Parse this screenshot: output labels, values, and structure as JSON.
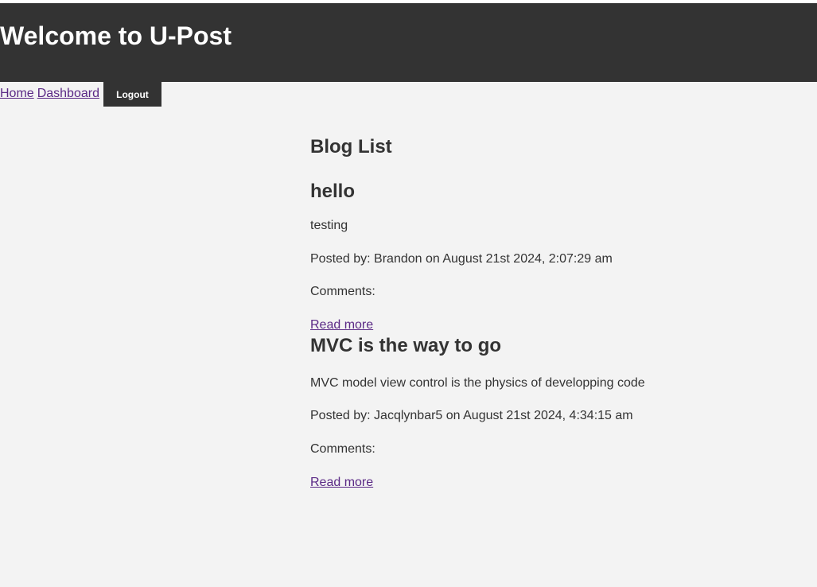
{
  "header": {
    "title": "Welcome to U-Post"
  },
  "nav": {
    "home": "Home",
    "dashboard": "Dashboard",
    "logout": "Logout"
  },
  "main": {
    "title": "Blog List",
    "posts": [
      {
        "title": "hello",
        "body": "testing",
        "meta": "Posted by: Brandon on August 21st 2024, 2:07:29 am",
        "comments": "Comments:",
        "read_more": "Read more"
      },
      {
        "title": "MVC is the way to go",
        "body": "MVC model view control is the physics of developping code",
        "meta": "Posted by: Jacqlynbar5 on August 21st 2024, 4:34:15 am",
        "comments": "Comments:",
        "read_more": "Read more"
      }
    ]
  },
  "colors": {
    "header_bg": "#333333",
    "page_bg": "#f3f3f3",
    "link": "#5b2a86",
    "text": "#333333"
  }
}
